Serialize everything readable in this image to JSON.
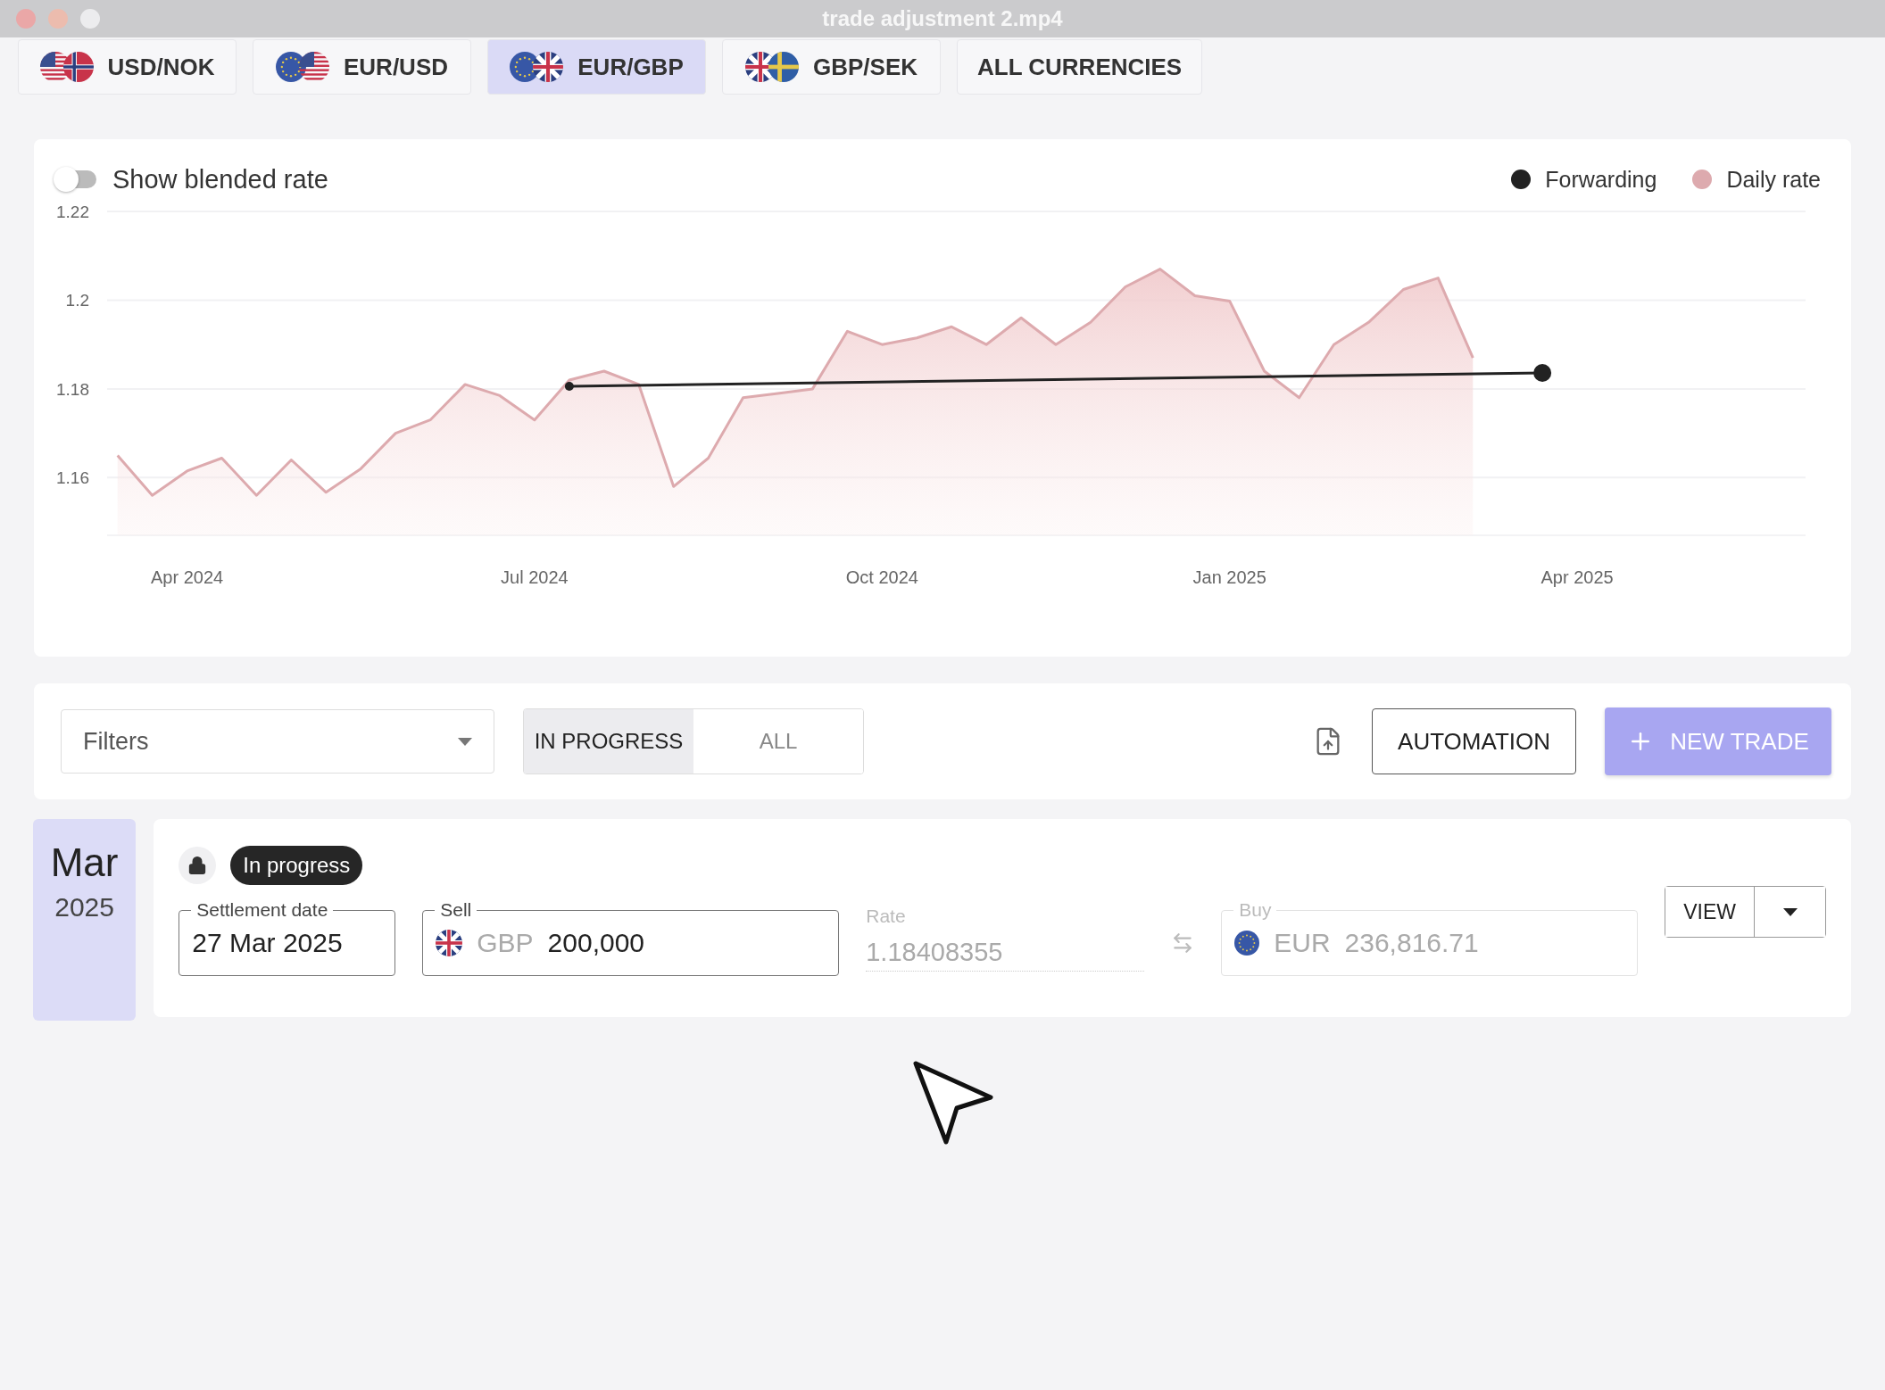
{
  "window": {
    "title": "trade adjustment 2.mp4"
  },
  "currency_tabs": [
    {
      "label": "USD/NOK",
      "selected": false,
      "flags": [
        {
          "kind": "us"
        },
        {
          "kind": "no"
        }
      ]
    },
    {
      "label": "EUR/USD",
      "selected": false,
      "flags": [
        {
          "kind": "eu"
        },
        {
          "kind": "us"
        }
      ]
    },
    {
      "label": "EUR/GBP",
      "selected": true,
      "flags": [
        {
          "kind": "eu"
        },
        {
          "kind": "gb"
        }
      ]
    },
    {
      "label": "GBP/SEK",
      "selected": false,
      "flags": [
        {
          "kind": "gb"
        },
        {
          "kind": "se"
        }
      ]
    },
    {
      "label": "ALL CURRENCIES",
      "selected": false
    }
  ],
  "chart": {
    "toggle": {
      "label": "Show blended rate",
      "on": false
    },
    "chart_data": {
      "type": "area",
      "grid": true,
      "ylim": [
        1.147,
        1.22
      ],
      "categories": [
        null,
        null,
        "Apr 2024",
        null,
        null,
        null,
        null,
        null,
        null,
        null,
        null,
        null,
        "Jul 2024",
        null,
        null,
        null,
        null,
        null,
        null,
        null,
        null,
        null,
        "Oct 2024",
        null,
        null,
        null,
        null,
        null,
        null,
        null,
        null,
        null,
        "Jan 2025",
        null,
        null,
        null,
        null,
        null,
        null,
        null,
        null,
        null,
        "Apr 2025"
      ],
      "yticks": [
        {
          "value": 1.16,
          "label": "1.16"
        },
        {
          "value": 1.18,
          "label": "1.18"
        },
        {
          "value": 1.2,
          "label": "1.2"
        },
        {
          "value": 1.22,
          "label": "1.22"
        }
      ],
      "series": [
        {
          "name": "Forwarding",
          "color": "#222222",
          "type": "line",
          "marker": "circle",
          "values": [
            null,
            null,
            null,
            null,
            null,
            null,
            null,
            null,
            null,
            null,
            null,
            null,
            null,
            1.1806,
            null,
            null,
            null,
            null,
            null,
            null,
            null,
            null,
            null,
            null,
            null,
            null,
            null,
            null,
            null,
            null,
            null,
            null,
            null,
            null,
            null,
            null,
            null,
            null,
            null,
            null,
            null,
            1.1836,
            null
          ]
        },
        {
          "name": "Daily rate",
          "color": "#ddaaae",
          "values": [
            1.165,
            1.156,
            1.1615,
            1.1644,
            1.156,
            1.164,
            1.1567,
            1.162,
            1.17,
            1.173,
            1.181,
            1.1785,
            1.173,
            1.182,
            1.184,
            1.181,
            1.158,
            1.1644,
            1.178,
            1.179,
            1.18,
            1.193,
            1.19,
            1.1915,
            1.194,
            1.19,
            1.196,
            1.19,
            1.195,
            1.203,
            1.207,
            1.201,
            1.1998,
            1.184,
            1.178,
            1.19,
            1.195,
            1.2024,
            1.205,
            1.187,
            null,
            null,
            null
          ]
        }
      ]
    }
  },
  "toolbar": {
    "filters": {
      "placeholder": "Filters"
    },
    "status_tabs": [
      {
        "label": "IN PROGRESS",
        "selected": true
      },
      {
        "label": "ALL",
        "selected": false
      }
    ],
    "automation": "AUTOMATION",
    "new_trade": "NEW TRADE"
  },
  "trade": {
    "month": "Mar",
    "year": "2025",
    "locked": true,
    "status": "In progress",
    "settlement_date": {
      "label": "Settlement date",
      "value": "27 Mar 2025"
    },
    "sell": {
      "label": "Sell",
      "currency": "GBP",
      "flag": {
        "kind": "gb"
      },
      "value": "200,000",
      "disabled": false
    },
    "rate": {
      "label": "Rate",
      "value": "1.18408355",
      "disabled": true
    },
    "buy": {
      "label": "Buy",
      "currency": "EUR",
      "flag": {
        "kind": "eu"
      },
      "value": "236,816.71",
      "disabled": true
    },
    "view": "VIEW"
  }
}
